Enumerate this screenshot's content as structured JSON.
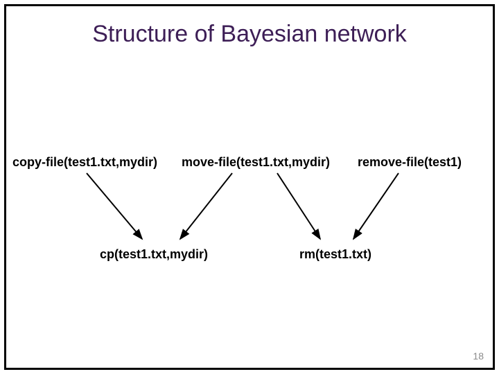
{
  "title": "Structure of Bayesian network",
  "top_nodes": {
    "copy": "copy-file(test1.txt,mydir)",
    "move": "move-file(test1.txt,mydir)",
    "remove": "remove-file(test1)"
  },
  "bottom_nodes": {
    "cp": "cp(test1.txt,mydir)",
    "rm": "rm(test1.txt)"
  },
  "page_number": "18"
}
